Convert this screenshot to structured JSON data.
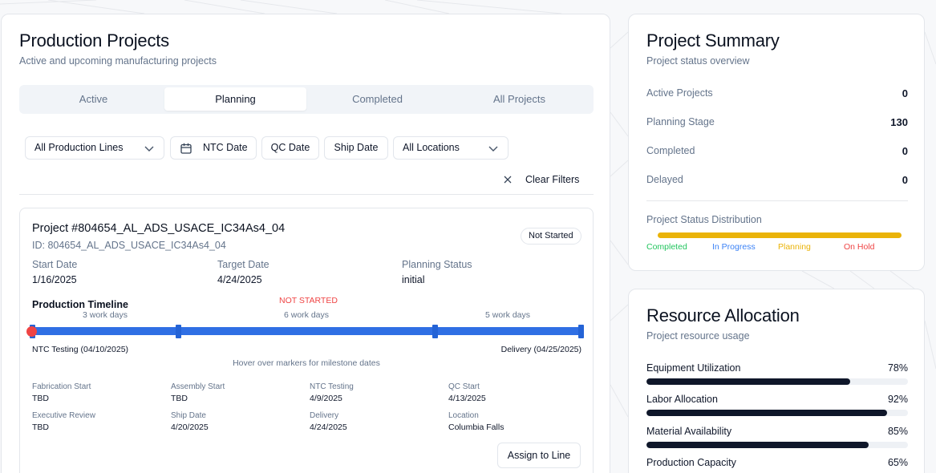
{
  "projects_panel": {
    "title": "Production Projects",
    "subtitle": "Active and upcoming manufacturing projects",
    "tabs": [
      {
        "label": "Active",
        "active": false
      },
      {
        "label": "Planning",
        "active": true
      },
      {
        "label": "Completed",
        "active": false
      },
      {
        "label": "All Projects",
        "active": false
      }
    ],
    "filters": {
      "production_lines": "All Production Lines",
      "ntc_date": "NTC Date",
      "qc_date": "QC Date",
      "ship_date": "Ship Date",
      "locations": "All Locations",
      "clear_filters": "Clear Filters"
    }
  },
  "project": {
    "title": "Project #804654_AL_ADS_USACE_IC34As4_04",
    "id_line": "ID: 804654_AL_ADS_USACE_IC34As4_04",
    "status_badge": "Not Started",
    "start_date_label": "Start Date",
    "start_date": "1/16/2025",
    "target_date_label": "Target Date",
    "target_date": "4/24/2025",
    "planning_status_label": "Planning Status",
    "planning_status": "initial",
    "timeline": {
      "title": "Production Timeline",
      "status": "NOT STARTED",
      "segments": [
        "3 work days",
        "6 work days",
        "5 work days"
      ],
      "start_label": "NTC Testing (04/10/2025)",
      "end_label": "Delivery (04/25/2025)",
      "hint": "Hover over markers for milestone dates",
      "progress_color": "#ef4444",
      "track_color": "#2f6fe4"
    },
    "milestones": [
      {
        "label": "Fabrication Start",
        "value": "TBD"
      },
      {
        "label": "Assembly Start",
        "value": "TBD"
      },
      {
        "label": "NTC Testing",
        "value": "4/9/2025"
      },
      {
        "label": "QC Start",
        "value": "4/13/2025"
      },
      {
        "label": "Executive Review",
        "value": "TBD"
      },
      {
        "label": "Ship Date",
        "value": "4/20/2025"
      },
      {
        "label": "Delivery",
        "value": "4/24/2025"
      },
      {
        "label": "Location",
        "value": "Columbia Falls"
      }
    ],
    "assign_button": "Assign to Line"
  },
  "summary": {
    "title": "Project Summary",
    "subtitle": "Project status overview",
    "rows": [
      {
        "label": "Active Projects",
        "value": "0"
      },
      {
        "label": "Planning Stage",
        "value": "130"
      },
      {
        "label": "Completed",
        "value": "0"
      },
      {
        "label": "Delayed",
        "value": "0"
      }
    ],
    "distribution_title": "Project Status Distribution",
    "distribution_color": "#eab308",
    "legend": [
      {
        "label": "Completed",
        "color": "#22c55e"
      },
      {
        "label": "In Progress",
        "color": "#3b82f6"
      },
      {
        "label": "Planning",
        "color": "#eab308"
      },
      {
        "label": "On Hold",
        "color": "#ef4444"
      }
    ]
  },
  "resources": {
    "title": "Resource Allocation",
    "subtitle": "Project resource usage",
    "items": [
      {
        "label": "Equipment Utilization",
        "value": "78%",
        "fraction": 0.78
      },
      {
        "label": "Labor Allocation",
        "value": "92%",
        "fraction": 0.92
      },
      {
        "label": "Material Availability",
        "value": "85%",
        "fraction": 0.85
      },
      {
        "label": "Production Capacity",
        "value": "65%",
        "fraction": 0.65
      }
    ]
  }
}
